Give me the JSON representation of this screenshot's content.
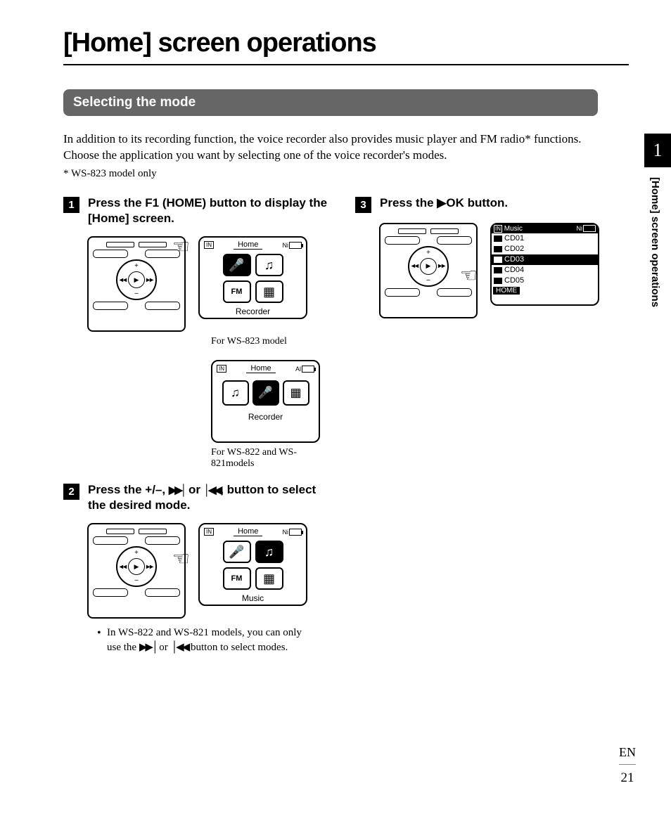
{
  "title_prefix": "[",
  "title_word": "Home",
  "title_suffix": "] screen operations",
  "section_heading": "Selecting the mode",
  "intro": "In addition to its recording function, the voice recorder also provides music player and FM radio* functions. Choose the application you want by selecting one of the voice recorder's modes.",
  "footnote": "* WS-823 model only",
  "steps": {
    "s1_num": "1",
    "s1_a": "Press the ",
    "s1_b": "F1",
    "s1_c": " (",
    "s1_d": "HOME",
    "s1_e": ") button to display the [",
    "s1_f": "Home",
    "s1_g": "] screen.",
    "s2_num": "2",
    "s2_a": "Press the +/–, ",
    "s2_b": " or ",
    "s2_c": ", button to select the desired mode.",
    "s3_num": "3",
    "s3_a": "Press the ",
    "s3_b": "OK",
    "s3_c": " button."
  },
  "caption1": "For WS-823 model",
  "caption2": "For WS-822 and WS-821models",
  "bullet_a": "In WS-822 and WS-821 models, you can only use the ",
  "bullet_b": " or ",
  "bullet_c": " button to select modes.",
  "lcd": {
    "home": "Home",
    "recorder": "Recorder",
    "music": "Music",
    "in": "IN",
    "ni": "Ni",
    "al": "Al",
    "fm": "FM"
  },
  "music_list": {
    "title": "Music",
    "items": [
      "CD01",
      "CD02",
      "CD03",
      "CD04",
      "CD05"
    ],
    "home": "HOME"
  },
  "side": {
    "chapter": "1",
    "label": "[Home] screen operations"
  },
  "footer": {
    "lang": "EN",
    "page": "21"
  }
}
